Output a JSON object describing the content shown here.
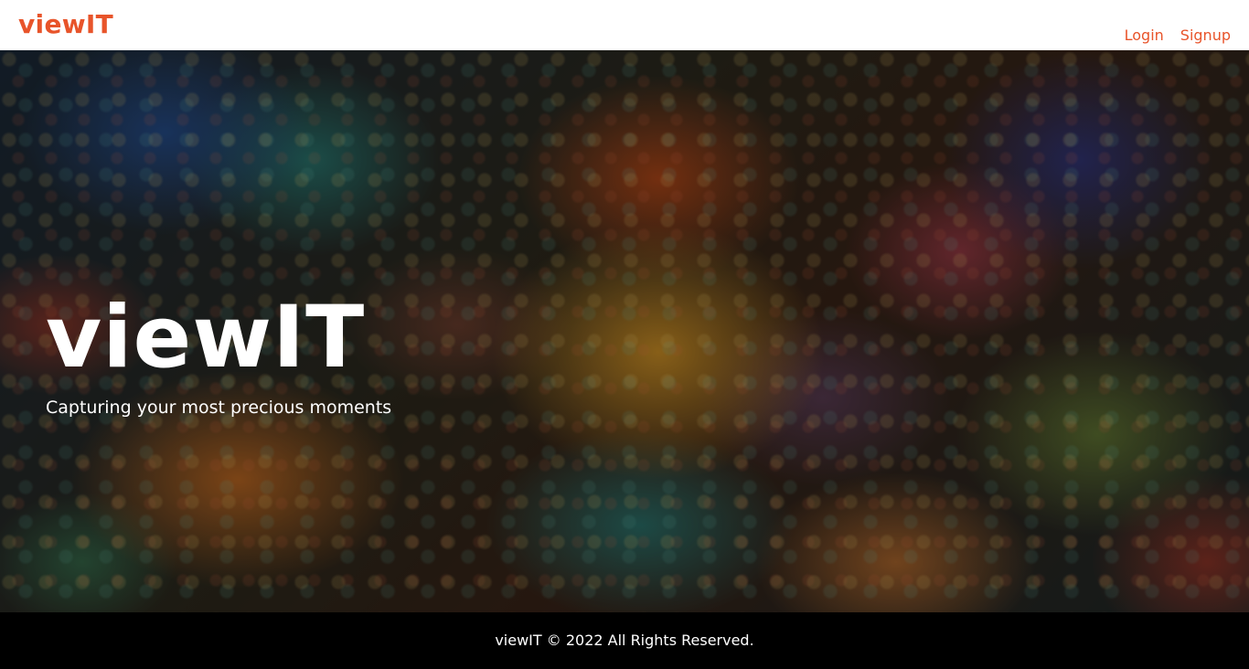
{
  "navbar": {
    "brand": "viewIT",
    "links": [
      {
        "label": "Login"
      },
      {
        "label": "Signup"
      }
    ],
    "accent_color": "#e8542a"
  },
  "hero": {
    "title": "viewIT",
    "subtitle": "Capturing your most precious moments"
  },
  "footer": {
    "text": "viewIT © 2022 All Rights Reserved."
  }
}
